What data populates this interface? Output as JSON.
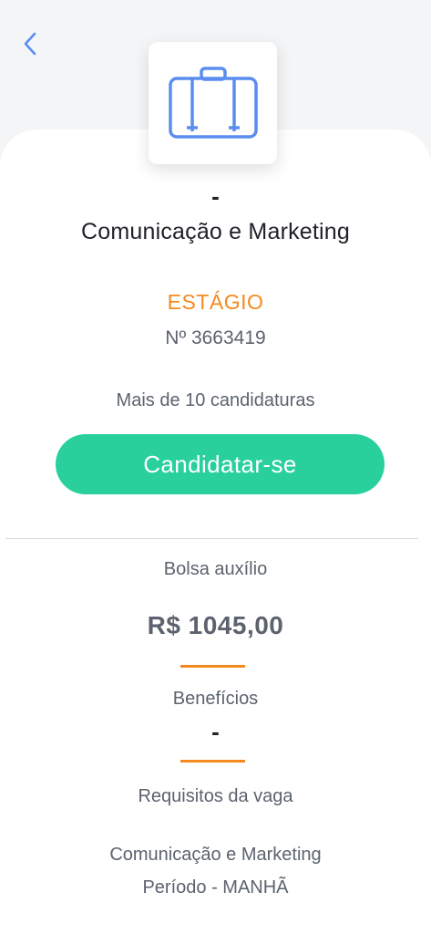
{
  "colors": {
    "accent_blue": "#5b8def",
    "accent_orange": "#f5891e",
    "apply_green": "#29d09c",
    "text_gray": "#5c636e",
    "text_dark": "#1f2128"
  },
  "header": {
    "back_icon": "chevron-left-icon",
    "job_icon": "briefcase-icon"
  },
  "job": {
    "company": "-",
    "title": "Comunicação e Marketing",
    "type": "ESTÁGIO",
    "number": "Nº 3663419",
    "applications": "Mais de 10 candidaturas",
    "apply_label": "Candidatar-se"
  },
  "details": {
    "salary_label": "Bolsa auxílio",
    "salary_value": "R$ 1045,00",
    "benefits_label": "Benefícios",
    "benefits_value": "-",
    "requirements_label": "Requisitos da vaga",
    "requirements_line1": "Comunicação e Marketing",
    "requirements_line2": "Período - MANHÃ"
  }
}
